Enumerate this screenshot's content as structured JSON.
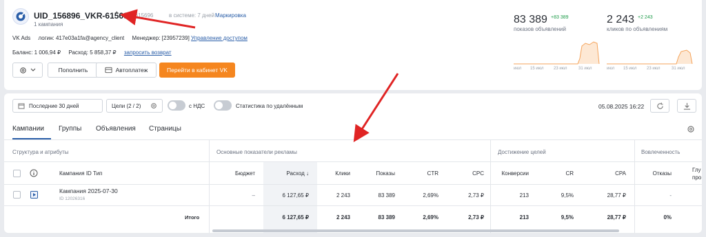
{
  "account": {
    "name": "UID_156896_VKR-615696",
    "campaign_count": "1 кампания",
    "id_label": "id: 615696",
    "days": "в системе: 7 дней",
    "marking": "Маркировка"
  },
  "details": {
    "platform": "VK Ads",
    "login": "логин: 417e03a1fa@agency_client",
    "manager_label": "Менеджер:",
    "manager_id": "[23957239]",
    "access": "Управление доступом",
    "balance": "Баланс: 1 006,94 ₽",
    "spend": "Расход: 5 858,37 ₽",
    "refund": "запросить возврат"
  },
  "buttons": {
    "add": "Пополнить",
    "autopay": "Автоплатеж",
    "goto": "Перейти в кабинет VK"
  },
  "stats": {
    "impressions": {
      "value": "83 389",
      "delta": "+83 389",
      "label": "показов объявлений"
    },
    "clicks": {
      "value": "2 243",
      "delta": "+2 243",
      "label": "кликов по объявлениям"
    },
    "ticks": [
      "июл",
      "15 июл",
      "23 июл",
      "31 июл"
    ]
  },
  "filters": {
    "period": "Последние 30 дней",
    "goals": "Цели (2 / 2)",
    "vat": "с НДС",
    "deleted": "Статистика по удалённым",
    "datetime": "05.08.2025 16:22"
  },
  "tabs": [
    "Кампании",
    "Группы",
    "Объявления",
    "Страницы"
  ],
  "groups": {
    "structure": "Структура и атрибуты",
    "main": "Основные показатели рекламы",
    "goals": "Достижение целей",
    "engagement": "Вовлеченность"
  },
  "columns": {
    "campaign": "Кампания  ID  Тип",
    "budget": "Бюджет",
    "spend": "Расход ↓",
    "clicks": "Клики",
    "impressions": "Показы",
    "ctr": "CTR",
    "cpc": "CPC",
    "conversions": "Конверсии",
    "cr": "CR",
    "cpa": "CPA",
    "bounces": "Отказы",
    "depth": "Глу про"
  },
  "rows": [
    {
      "name": "Кампания 2025-07-30",
      "id": "ID 12026316",
      "budget": "–",
      "spend": "6 127,65 ₽",
      "clicks": "2 243",
      "impressions": "83 389",
      "ctr": "2,69%",
      "cpc": "2,73 ₽",
      "conversions": "213",
      "cr": "9,5%",
      "cpa": "28,77 ₽",
      "bounces": "-"
    }
  ],
  "total": {
    "label": "Итого",
    "spend": "6 127,65 ₽",
    "clicks": "2 243",
    "impressions": "83 389",
    "ctr": "2,69%",
    "cpc": "2,73 ₽",
    "conversions": "213",
    "cr": "9,5%",
    "cpa": "28,77 ₽",
    "bounces": "0%"
  },
  "colors": {
    "accent": "#2a5ea8",
    "orange": "#f5861f",
    "positive": "#1b9a47",
    "annotation": "#e02424"
  }
}
